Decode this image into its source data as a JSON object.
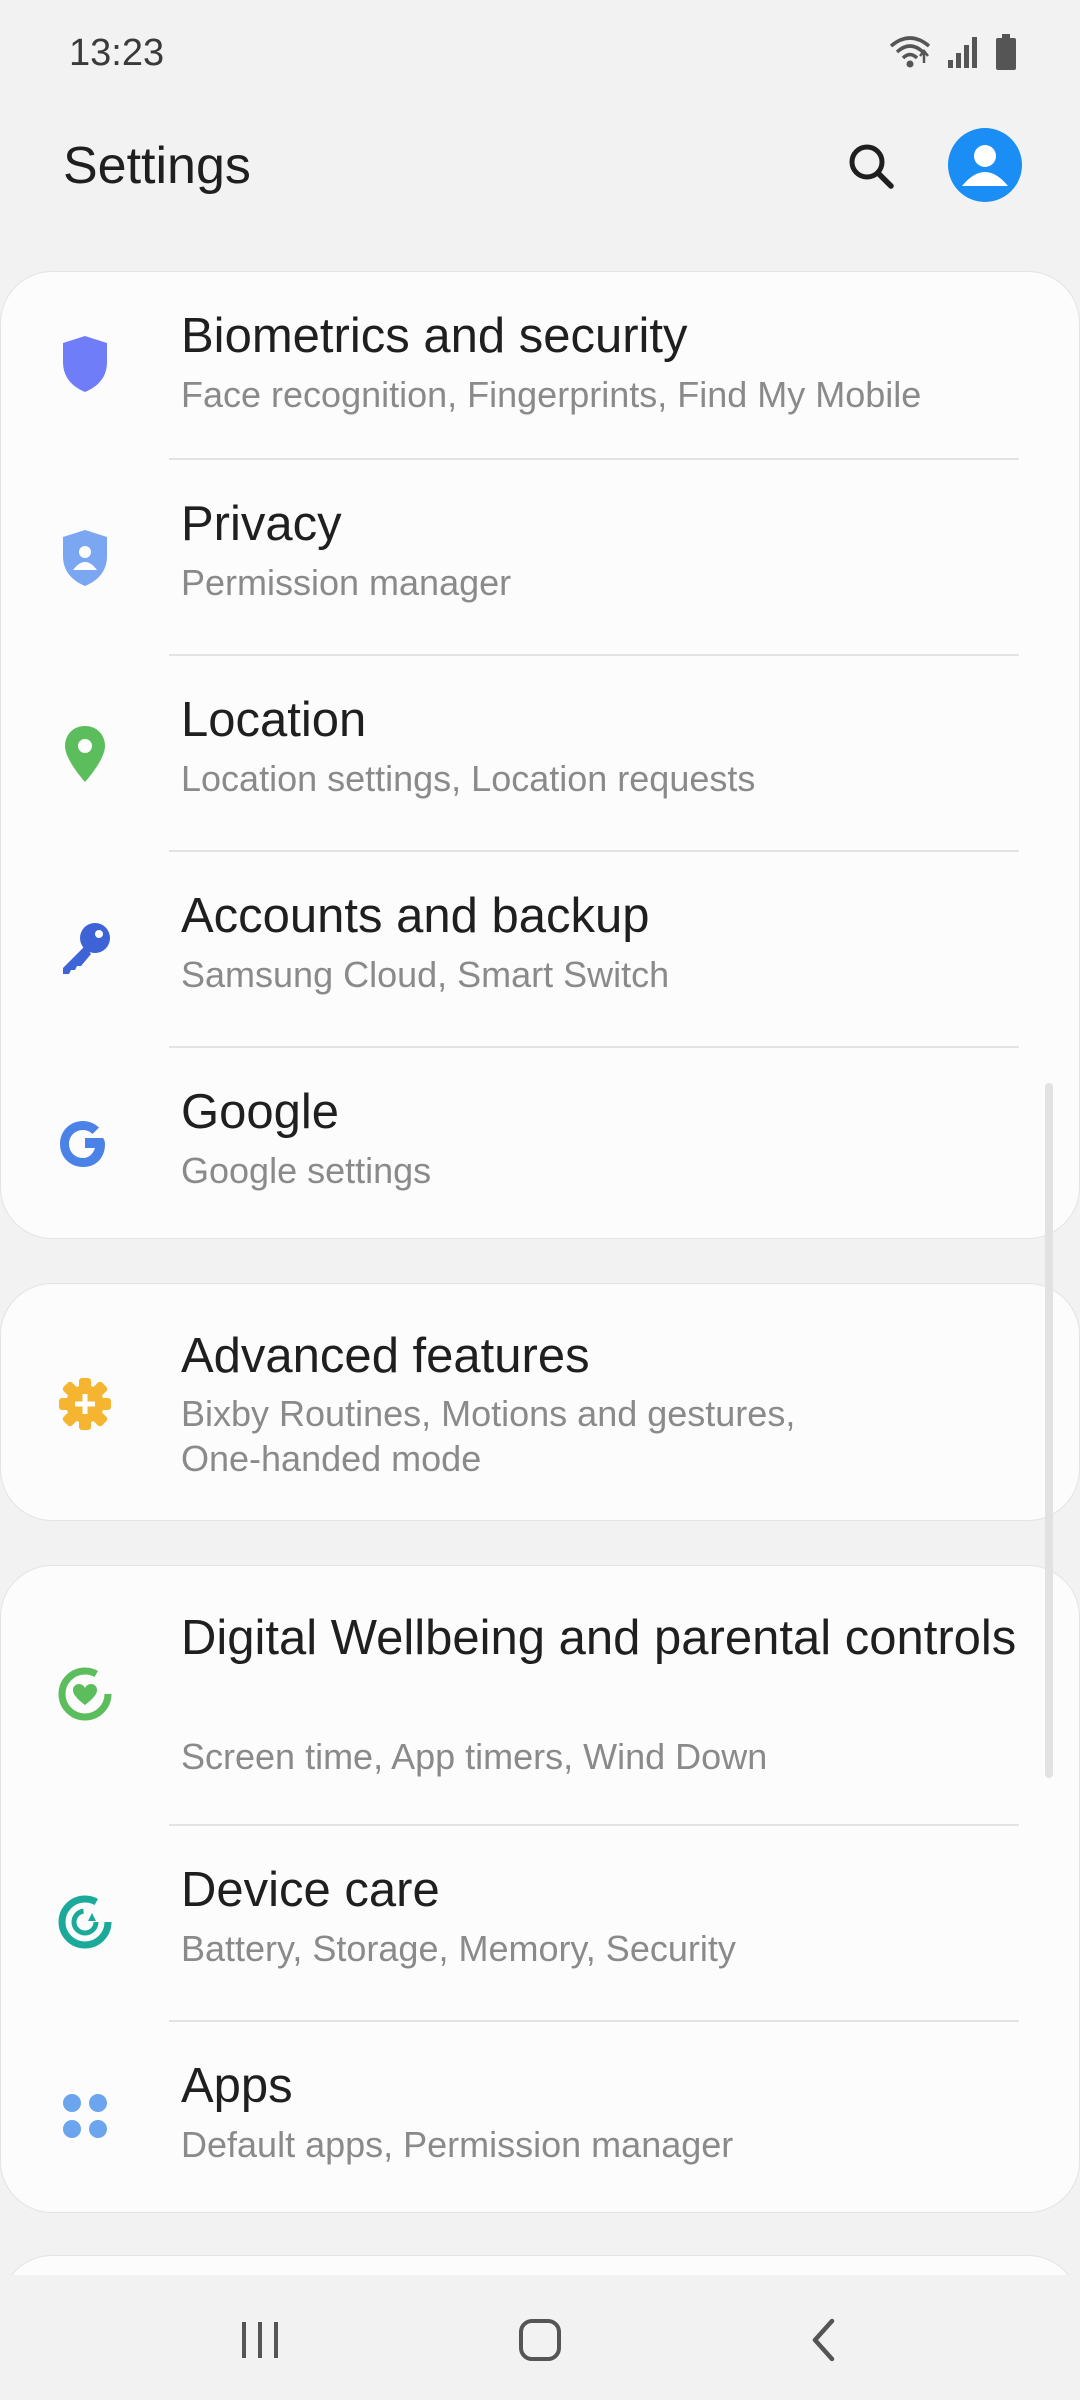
{
  "status_bar": {
    "time": "13:23",
    "icons": [
      "wifi-icon",
      "signal-icon",
      "battery-icon"
    ]
  },
  "header": {
    "title": "Settings",
    "search_icon": "search-icon",
    "avatar_icon": "profile-avatar-icon",
    "avatar_color": "#1a8ef4"
  },
  "groups": [
    {
      "items": [
        {
          "title": "Biometrics and security",
          "subtitle": "Face recognition, Fingerprints, Find My Mobile",
          "icon": "shield-icon",
          "icon_color": "#6f7ef8"
        },
        {
          "title": "Privacy",
          "subtitle": "Permission manager",
          "icon": "privacy-shield-icon",
          "icon_color": "#7aa6f2"
        },
        {
          "title": "Location",
          "subtitle": "Location settings, Location requests",
          "icon": "location-pin-icon",
          "icon_color": "#5cbd5c"
        },
        {
          "title": "Accounts and backup",
          "subtitle": "Samsung Cloud, Smart Switch",
          "icon": "key-icon",
          "icon_color": "#3e63d6"
        },
        {
          "title": "Google",
          "subtitle": "Google settings",
          "icon": "google-icon",
          "icon_color": "#4a82e8"
        }
      ]
    },
    {
      "items": [
        {
          "title": "Advanced features",
          "subtitle": "Bixby Routines, Motions and gestures, One-handed mode",
          "icon": "advanced-gear-plus-icon",
          "icon_color": "#f5b530"
        }
      ]
    },
    {
      "items": [
        {
          "title": "Digital Wellbeing and parental controls",
          "subtitle": "Screen time, App timers, Wind Down",
          "icon": "wellbeing-heart-icon",
          "icon_color": "#5cbd5c"
        },
        {
          "title": "Device care",
          "subtitle": "Battery, Storage, Memory, Security",
          "icon": "device-care-icon",
          "icon_color": "#1ba99a"
        },
        {
          "title": "Apps",
          "subtitle": "Default apps, Permission manager",
          "icon": "apps-grid-icon",
          "icon_color": "#6aa5ee"
        }
      ]
    }
  ],
  "nav_bar": {
    "buttons": [
      "recents-icon",
      "home-icon",
      "back-icon"
    ]
  }
}
